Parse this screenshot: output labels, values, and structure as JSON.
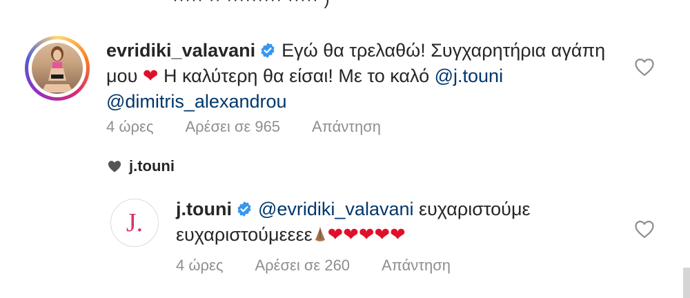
{
  "top_partial_text": "····· ·· ········· ····· )",
  "comment1": {
    "username": "evridiki_valavani",
    "text_part1": "Εγώ θα τρελαθώ! Συγχαρητήρια αγάπη μου ",
    "heart": "❤",
    "text_part2": " Η καλύτερη θα είσαι! Με το καλό ",
    "mention1": "@j.touni",
    "mention2": "@dimitris_alexandrou",
    "time": "4 ώρες",
    "likes": "Αρέσει σε 965",
    "reply": "Απάντηση"
  },
  "liked_by_author": "j.touni",
  "comment2": {
    "avatar_letter": "J.",
    "username": "j.touni",
    "mention": "@evridiki_valavani",
    "text": " ευχαριστούμε ευχαριστούμεεεε",
    "hearts": "❤❤❤❤❤",
    "time": "4 ώρες",
    "likes": "Αρέσει σε 260",
    "reply": "Απάντηση"
  },
  "colors": {
    "mention": "#00376b",
    "verified": "#3897f0",
    "heart": "#e0102a",
    "meta": "#8e8e8e",
    "avatar_letter": "#d6336c"
  }
}
